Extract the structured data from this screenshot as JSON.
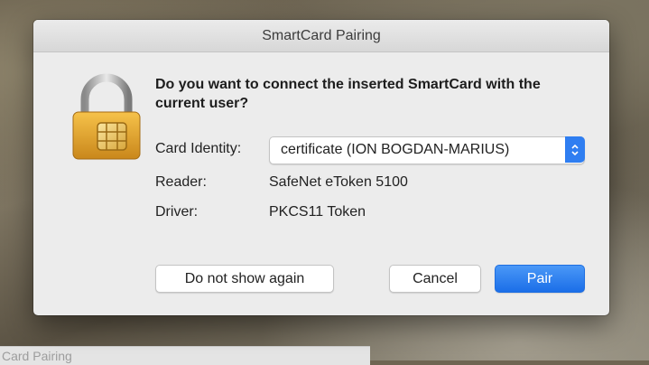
{
  "dialog": {
    "title": "SmartCard Pairing",
    "question": "Do you want to connect the inserted SmartCard with the current user?",
    "card_identity": {
      "label": "Card Identity:",
      "selected": "certificate (ION BOGDAN-MARIUS)"
    },
    "reader": {
      "label": "Reader:",
      "value": "SafeNet eToken 5100"
    },
    "driver": {
      "label": "Driver:",
      "value": "PKCS11 Token"
    },
    "buttons": {
      "dont_show": "Do not show again",
      "cancel": "Cancel",
      "pair": "Pair"
    },
    "icon": "smartcard-lock-icon",
    "accent_color": "#2f7ef1"
  },
  "background_window": {
    "title": "Card Pairing"
  }
}
